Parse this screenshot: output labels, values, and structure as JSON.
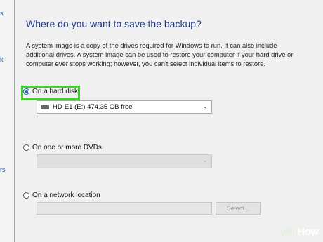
{
  "left_strip": {
    "line1": "s",
    "line2": "k-",
    "line3": "rs"
  },
  "heading": "Where do you want to save the backup?",
  "description": "A system image is a copy of the drives required for Windows to run. It can also include additional drives. A system image can be used to restore your computer if your hard drive or computer ever stops working; however, you can't select individual items to restore.",
  "options": {
    "hard_disk": {
      "label": "On a hard disk",
      "selected": true
    },
    "dvds": {
      "label": "On one or more DVDs",
      "selected": false
    },
    "network": {
      "label": "On a network location",
      "selected": false
    }
  },
  "hard_disk_dropdown": {
    "value": "HD-E1 (E:)  474.35 GB free"
  },
  "network_select_button": "Select...",
  "watermark": {
    "prefix": "wiki",
    "suffix": "How"
  },
  "colors": {
    "highlight": "#3bd625",
    "heading": "#1e3a8a",
    "radio_selected": "#1e5fb8"
  }
}
